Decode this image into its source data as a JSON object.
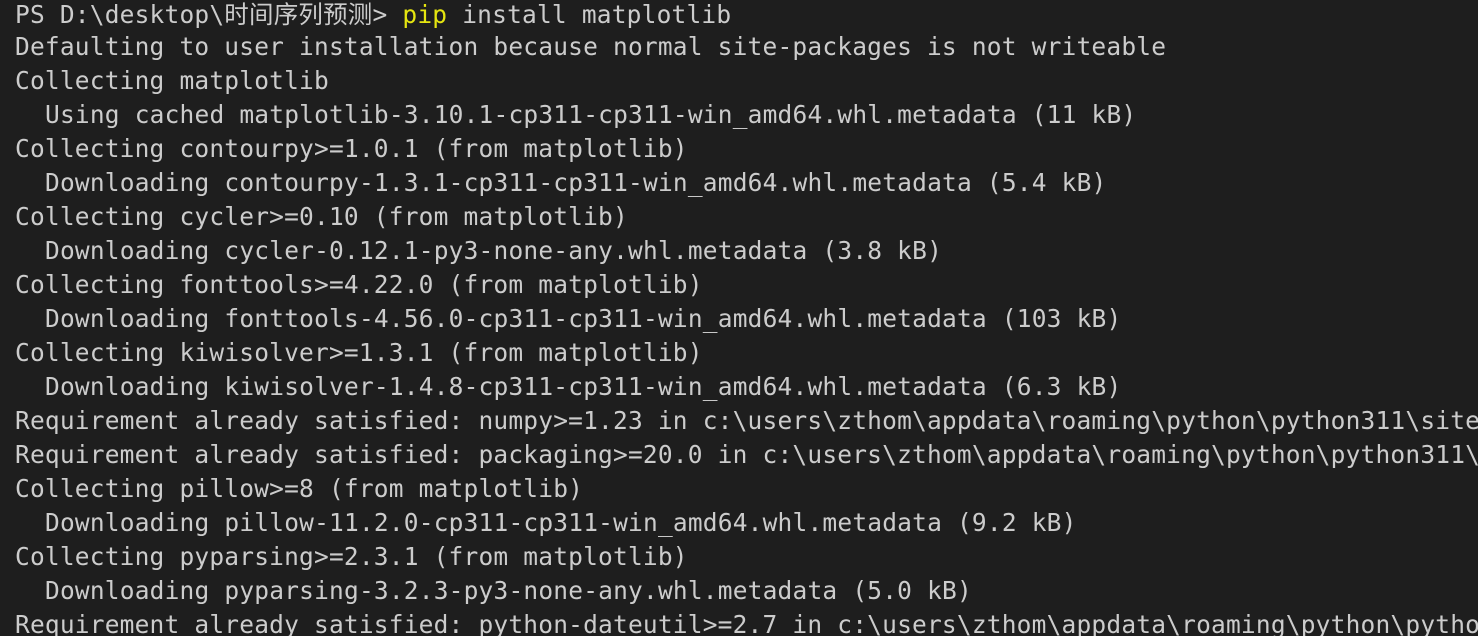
{
  "colors": {
    "background": "#1e1e1e",
    "foreground": "#cccccc",
    "command_highlight": "#e5e510"
  },
  "prompt": {
    "path": "PS D:\\desktop\\时间序列预测> ",
    "command": "pip",
    "args": " install matplotlib"
  },
  "output": [
    {
      "text": "Defaulting to user installation because normal site-packages is not writeable",
      "indent": false
    },
    {
      "text": "Collecting matplotlib",
      "indent": false
    },
    {
      "text": "Using cached matplotlib-3.10.1-cp311-cp311-win_amd64.whl.metadata (11 kB)",
      "indent": true
    },
    {
      "text": "Collecting contourpy>=1.0.1 (from matplotlib)",
      "indent": false
    },
    {
      "text": "Downloading contourpy-1.3.1-cp311-cp311-win_amd64.whl.metadata (5.4 kB)",
      "indent": true
    },
    {
      "text": "Collecting cycler>=0.10 (from matplotlib)",
      "indent": false
    },
    {
      "text": "Downloading cycler-0.12.1-py3-none-any.whl.metadata (3.8 kB)",
      "indent": true
    },
    {
      "text": "Collecting fonttools>=4.22.0 (from matplotlib)",
      "indent": false
    },
    {
      "text": "Downloading fonttools-4.56.0-cp311-cp311-win_amd64.whl.metadata (103 kB)",
      "indent": true
    },
    {
      "text": "Collecting kiwisolver>=1.3.1 (from matplotlib)",
      "indent": false
    },
    {
      "text": "Downloading kiwisolver-1.4.8-cp311-cp311-win_amd64.whl.metadata (6.3 kB)",
      "indent": true
    },
    {
      "text": "Requirement already satisfied: numpy>=1.23 in c:\\users\\zthom\\appdata\\roaming\\python\\python311\\site",
      "indent": false
    },
    {
      "text": "Requirement already satisfied: packaging>=20.0 in c:\\users\\zthom\\appdata\\roaming\\python\\python311\\",
      "indent": false
    },
    {
      "text": "Collecting pillow>=8 (from matplotlib)",
      "indent": false
    },
    {
      "text": "Downloading pillow-11.2.0-cp311-cp311-win_amd64.whl.metadata (9.2 kB)",
      "indent": true
    },
    {
      "text": "Collecting pyparsing>=2.3.1 (from matplotlib)",
      "indent": false
    },
    {
      "text": "Downloading pyparsing-3.2.3-py3-none-any.whl.metadata (5.0 kB)",
      "indent": true
    },
    {
      "text": "Requirement already satisfied: python-dateutil>=2.7 in c:\\users\\zthom\\appdata\\roaming\\python\\pytho",
      "indent": false
    }
  ]
}
